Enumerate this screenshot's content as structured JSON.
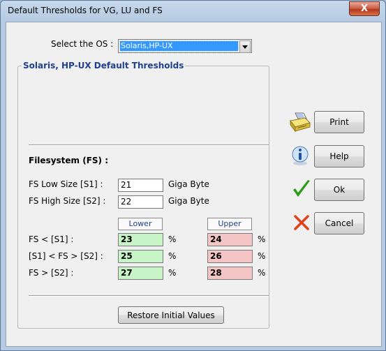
{
  "window": {
    "title": "Default Thresholds for VG, LU and FS",
    "close_glyph": "X"
  },
  "os_select": {
    "label": "Select the OS :",
    "value": "Solaris,HP-UX"
  },
  "group": {
    "title": "Solaris, HP-UX Default Thresholds"
  },
  "filesystem": {
    "heading": "Filesystem (FS) :",
    "low_size_label": "FS Low Size [S1] :",
    "low_size_value": "21",
    "high_size_label": "FS High Size [S2] :",
    "high_size_value": "22",
    "unit": "Giga Byte",
    "lower_header": "Lower",
    "upper_header": "Upper",
    "percent": "%",
    "rows": [
      {
        "label": "FS < [S1] :",
        "lower": "23",
        "upper": "24"
      },
      {
        "label": "[S1] < FS > [S2] :",
        "lower": "25",
        "upper": "26"
      },
      {
        "label": "FS > [S2] :",
        "lower": "27",
        "upper": "28"
      }
    ]
  },
  "buttons": {
    "print": "Print",
    "help": "Help",
    "ok": "Ok",
    "cancel": "Cancel",
    "restore": "Restore Initial Values"
  },
  "icons": {
    "print": "printer-icon",
    "help": "info-icon",
    "ok": "checkmark-icon",
    "cancel": "cross-icon"
  },
  "colors": {
    "lower_bg": "#c8f5c8",
    "upper_bg": "#f5c4c4",
    "group_title": "#1f3f8f",
    "ok_check": "#2e9b1a",
    "cancel_x": "#e0401a"
  }
}
